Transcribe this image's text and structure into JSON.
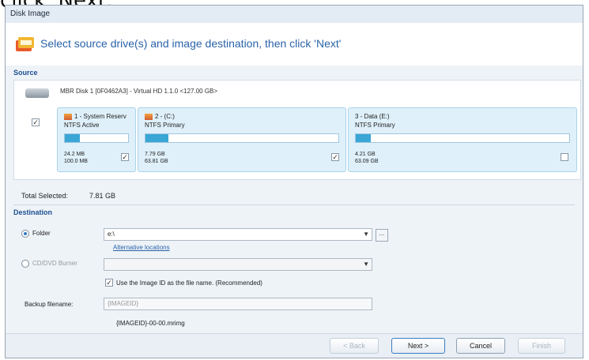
{
  "caption": "click 'Next.",
  "window": {
    "title": "Disk Image"
  },
  "header": {
    "instruction": "Select source drive(s) and image destination, then click 'Next'"
  },
  "source": {
    "section_label": "Source",
    "disk_label": "MBR Disk 1 [0F0462A3] - Virtual HD 1.1.0  <127.00 GB>",
    "partitions": [
      {
        "name": "1 - System Reserv",
        "type": "NTFS Active",
        "used": "24.2 MB",
        "total": "100.0 MB",
        "checked": true,
        "fill": 0.24
      },
      {
        "name": "2 - (C:)",
        "type": "NTFS Primary",
        "used": "7.79 GB",
        "total": "63.81 GB",
        "checked": true,
        "fill": 0.12
      },
      {
        "name": "3 - Data (E:)",
        "type": "NTFS Primary",
        "used": "4.21 GB",
        "total": "63.09 GB",
        "checked": false,
        "fill": 0.07
      }
    ],
    "total_label": "Total Selected:",
    "total_value": "7.81 GB"
  },
  "destination": {
    "section_label": "Destination",
    "folder_label": "Folder",
    "folder_value": "e:\\",
    "alt_locations": "Alternative locations",
    "burner_label": "CD/DVD Burner",
    "use_id_label": "Use the Image ID as the file name.  (Recommended)",
    "backup_label": "Backup filename:",
    "backup_value": "{IMAGEID}",
    "filename_preview": "{IMAGEID}-00-00.mrimg",
    "browse_label": "..."
  },
  "footer": {
    "back": "< Back",
    "next": "Next >",
    "cancel": "Cancel",
    "finish": "Finish"
  },
  "colors": {
    "accent": "#2a63a8",
    "partition_fill": "#39a6d6"
  }
}
